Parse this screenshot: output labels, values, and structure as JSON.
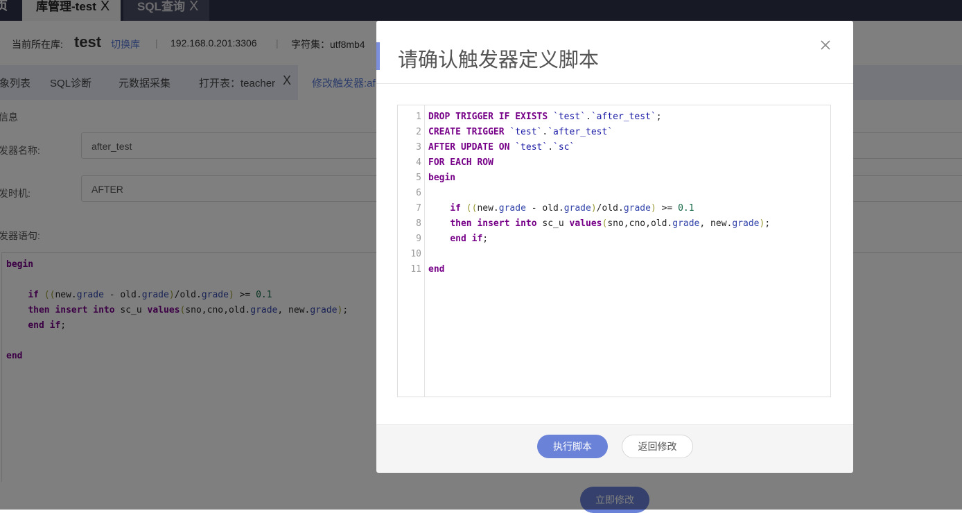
{
  "top_tabs": [
    {
      "label": "页"
    },
    {
      "label": "库管理-test",
      "close": "X"
    },
    {
      "label": "SQL查询",
      "close": "X"
    }
  ],
  "db_bar": {
    "current_label": "当前所在库:",
    "db_name": "test",
    "switch_label": "切换库",
    "separator": "|",
    "host": "192.168.0.201:3306",
    "charset": "字符集：utf8mb4"
  },
  "sub_tabs": [
    {
      "label": "象列表"
    },
    {
      "label": "SQL诊断"
    },
    {
      "label": "元数据采集"
    },
    {
      "label": "打开表：teacher",
      "close": "X"
    },
    {
      "label": "修改触发器:af"
    }
  ],
  "form": {
    "section_label": "信息",
    "name_label": "发器名称:",
    "name_value": "after_test",
    "timing_label": "发时机:",
    "timing_value": "AFTER",
    "statement_label": "发器语句:",
    "submit_label": "立即修改"
  },
  "modal": {
    "title": "请确认触发器定义脚本",
    "close_icon": "close-icon",
    "line_numbers": "1\n2\n3\n4\n5\n6\n7\n8\n9\n10\n11",
    "execute_label": "执行脚本",
    "back_label": "返回修改"
  },
  "colors": {
    "accent": "#6a82d8",
    "keyword": "#770088",
    "top_bar": "#2f3349",
    "subtab_bg": "#e8ecf7"
  }
}
